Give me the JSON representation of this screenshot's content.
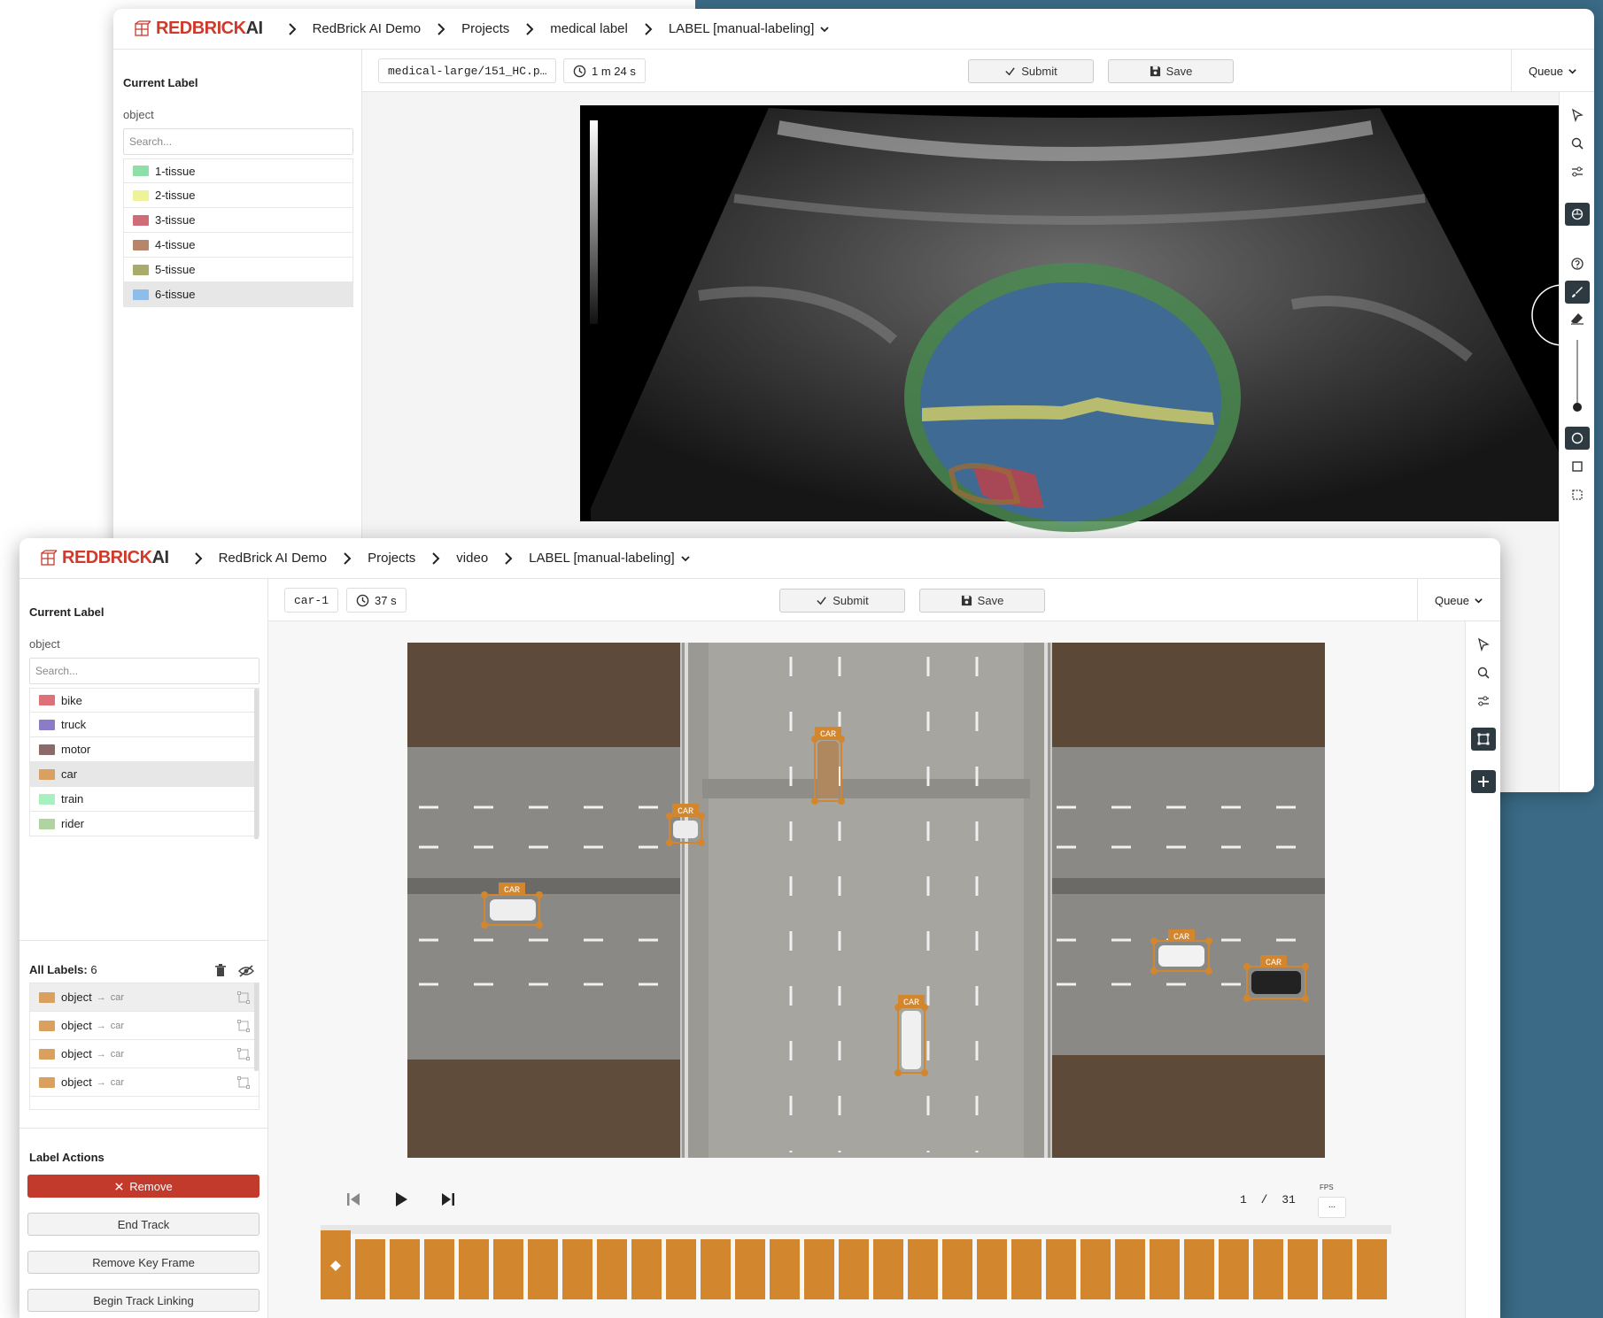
{
  "brand": {
    "red": "REDBRICK",
    "ai": "AI"
  },
  "colors": {
    "accent": "#d2872f",
    "danger": "#c23a2b",
    "toolActive": "#2e3a42",
    "background": "#3a6a86"
  },
  "window1": {
    "breadcrumb": [
      "RedBrick AI Demo",
      "Projects",
      "medical label",
      "LABEL [manual-labeling]"
    ],
    "current_label_title": "Current Label",
    "category": "object",
    "search_placeholder": "Search...",
    "classes": [
      {
        "name": "1-tissue",
        "color": "#8fe0a8"
      },
      {
        "name": "2-tissue",
        "color": "#eef39a"
      },
      {
        "name": "3-tissue",
        "color": "#cf6c78"
      },
      {
        "name": "4-tissue",
        "color": "#b7866a"
      },
      {
        "name": "5-tissue",
        "color": "#a8ab6a"
      },
      {
        "name": "6-tissue",
        "color": "#8dbde8"
      }
    ],
    "selected_class": "6-tissue",
    "file_name": "medical-large/151_HC.p…",
    "timer": "1 m 24 s",
    "submit_label": "Submit",
    "save_label": "Save",
    "queue_label": "Queue",
    "tools": [
      "pointer-icon",
      "zoom-icon",
      "sliders-icon",
      "segment-icon",
      "help-icon",
      "brush-icon",
      "eraser-icon",
      "circle-icon",
      "square-icon",
      "bbox-dashed-icon"
    ]
  },
  "window2": {
    "breadcrumb": [
      "RedBrick AI Demo",
      "Projects",
      "video",
      "LABEL [manual-labeling]"
    ],
    "current_label_title": "Current Label",
    "category": "object",
    "search_placeholder": "Search...",
    "classes": [
      {
        "name": "bike",
        "color": "#e07078"
      },
      {
        "name": "truck",
        "color": "#8c7cc8"
      },
      {
        "name": "motor",
        "color": "#8a6a6a"
      },
      {
        "name": "car",
        "color": "#d9a060"
      },
      {
        "name": "train",
        "color": "#a8f0c0"
      },
      {
        "name": "rider",
        "color": "#b0d4a0"
      }
    ],
    "selected_class": "car",
    "all_labels_title": "All Labels:",
    "all_labels_count": "6",
    "labels": [
      {
        "name": "object",
        "cls": "car"
      },
      {
        "name": "object",
        "cls": "car"
      },
      {
        "name": "object",
        "cls": "car"
      },
      {
        "name": "object",
        "cls": "car"
      }
    ],
    "label_actions_title": "Label Actions",
    "actions": {
      "remove": "Remove",
      "end_track": "End Track",
      "remove_keyframe": "Remove Key Frame",
      "track_linking": "Begin Track Linking"
    },
    "file_name": "car-1",
    "timer": "37 s",
    "submit_label": "Submit",
    "save_label": "Save",
    "queue_label": "Queue",
    "car_tag": "CAR",
    "frame_current": "1",
    "frame_total": "31",
    "frame_sep": "/",
    "fps_label": "FPS",
    "fps_value": "...",
    "keyframe_count": 31,
    "tools": [
      "pointer-icon",
      "zoom-icon",
      "sliders-icon",
      "bbox-icon",
      "plus-icon"
    ]
  }
}
